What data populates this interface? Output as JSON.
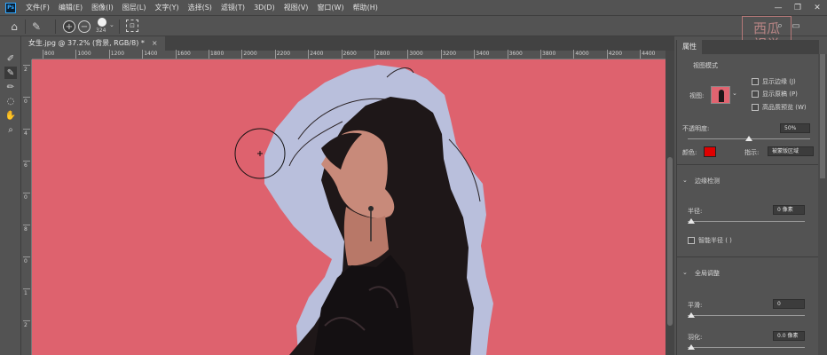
{
  "menubar": {
    "logo": "Ps",
    "items": [
      "文件(F)",
      "编辑(E)",
      "图像(I)",
      "图层(L)",
      "文字(Y)",
      "选择(S)",
      "滤镜(T)",
      "3D(D)",
      "视图(V)",
      "窗口(W)",
      "帮助(H)"
    ],
    "window_controls": [
      "—",
      "❐",
      "✕"
    ]
  },
  "options_bar": {
    "brush_size": "324",
    "add_mode_symbol": "+",
    "subtract_mode_symbol": "−"
  },
  "watermark": {
    "line1": "西瓜",
    "line2": "视觉"
  },
  "document": {
    "tab_title": "女生.jpg @ 37.2% (背景, RGB/8) *",
    "close": "×"
  },
  "ruler": {
    "top_ticks": [
      "800",
      "1000",
      "1200",
      "1400",
      "1600",
      "1800",
      "2000",
      "2200",
      "2400",
      "2600",
      "2800",
      "3000",
      "3200",
      "3400",
      "3600",
      "3800",
      "4000",
      "4200",
      "4400"
    ],
    "left_ticks": [
      "2",
      "0",
      "4",
      "6",
      "0",
      "8",
      "0",
      "1",
      "2"
    ]
  },
  "panel": {
    "tab_label": "属性",
    "view_mode_title": "视图模式",
    "view_label": "视图:",
    "show_edge": "显示边缘 (J)",
    "show_original": "显示原稿 (P)",
    "high_quality": "高品质预览 (W)",
    "opacity_label": "不透明度:",
    "opacity_value": "50%",
    "opacity_level": 0.5,
    "color_label": "颜色:",
    "color_value": "#e00000",
    "indicate_label": "指示:",
    "indicate_value": "被蒙版区域",
    "edge_detection_title": "边缘检测",
    "radius_label": "半径:",
    "radius_value": "0 像素",
    "smart_radius": "智能半径 ( )",
    "global_refine_title": "全局调整",
    "smooth_label": "平滑:",
    "smooth_value": "0",
    "feather_label": "羽化:",
    "feather_value": "0.0 像素"
  },
  "colors": {
    "canvas_bg": "#e16470",
    "overlay": "#b9bfdc",
    "hair": "#1e1718",
    "skin": "#c88a7a"
  }
}
